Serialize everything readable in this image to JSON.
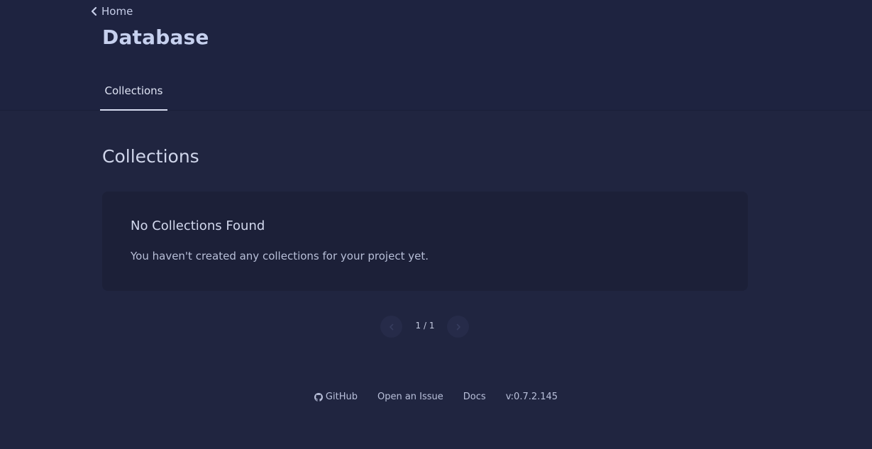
{
  "nav": {
    "back_label": "Home",
    "back_icon": "chevron-left-icon"
  },
  "header": {
    "title": "Database",
    "tabs": [
      {
        "label": "Collections",
        "active": true
      }
    ]
  },
  "main": {
    "section_title": "Collections",
    "empty_state": {
      "title": "No Collections Found",
      "message": "You haven't created any collections for your project yet."
    },
    "pagination": {
      "current": 1,
      "total": 1,
      "label": "1 / 1"
    }
  },
  "footer": {
    "links": [
      {
        "label": "GitHub",
        "icon": "github-icon"
      },
      {
        "label": "Open an Issue"
      },
      {
        "label": "Docs"
      }
    ],
    "version": "v:0.7.2.145"
  },
  "colors": {
    "background": "#202540",
    "card": "#1c2038",
    "text": "#c9cfe6"
  }
}
